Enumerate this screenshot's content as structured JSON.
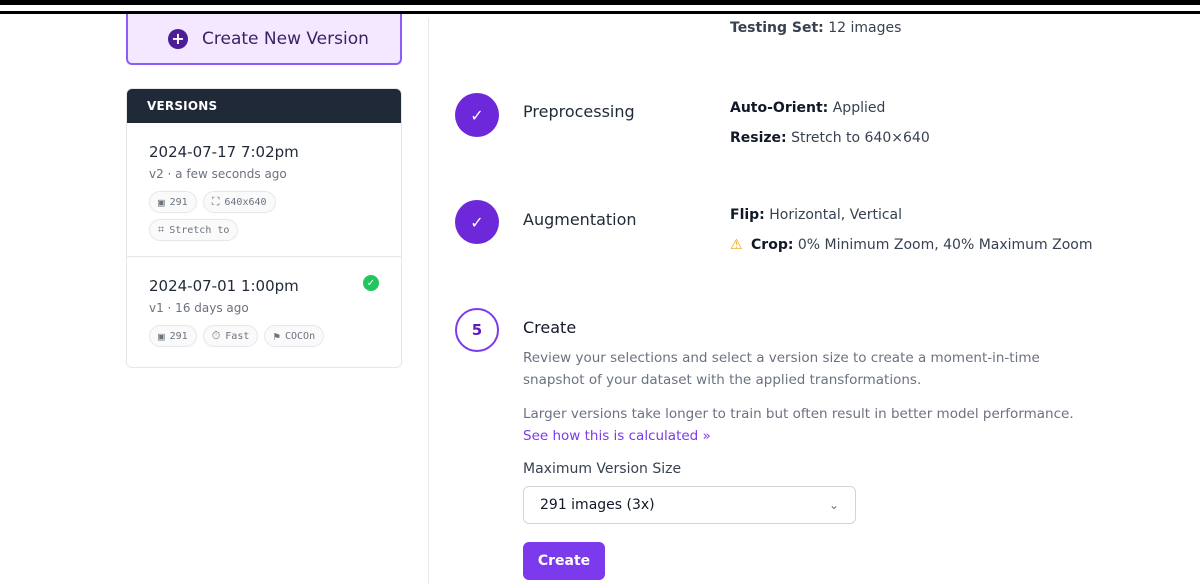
{
  "sidebar": {
    "create_button_label": "Create New Version",
    "versions_header": "VERSIONS",
    "versions": [
      {
        "title": "2024-07-17 7:02pm",
        "subtitle": "v2 · a few seconds ago",
        "chips": [
          "291",
          "640x640",
          "Stretch to"
        ]
      },
      {
        "title": "2024-07-01 1:00pm",
        "subtitle": "v1 · 16 days ago",
        "chips": [
          "291",
          "Fast",
          "COCOn"
        ],
        "status": "check"
      }
    ]
  },
  "main": {
    "testing": {
      "label": "Testing Set:",
      "value": "12 images"
    },
    "steps": [
      {
        "label": "Preprocessing",
        "details": [
          {
            "key": "Auto-Orient:",
            "value": "Applied"
          },
          {
            "key": "Resize:",
            "value": "Stretch to 640×640"
          }
        ]
      },
      {
        "label": "Augmentation",
        "details": [
          {
            "key": "Flip:",
            "value": "Horizontal, Vertical"
          },
          {
            "key": "Crop:",
            "value": "0% Minimum Zoom, 40% Maximum Zoom"
          }
        ]
      }
    ],
    "create_step": {
      "number": "5",
      "title": "Create",
      "desc1": "Review your selections and select a version size to create a moment-in-time snapshot of your dataset with the applied transformations.",
      "desc2_text": "Larger versions take longer to train but often result in better model performance.",
      "desc2_link": "See how this is calculated »",
      "max_label": "Maximum Version Size",
      "select_value": "291 images (3x)",
      "submit_label": "Create"
    }
  },
  "colors": {
    "accent": "#7c3aed",
    "dark_header": "#1f2937",
    "success": "#22c55e",
    "warning": "#f59e0b"
  }
}
